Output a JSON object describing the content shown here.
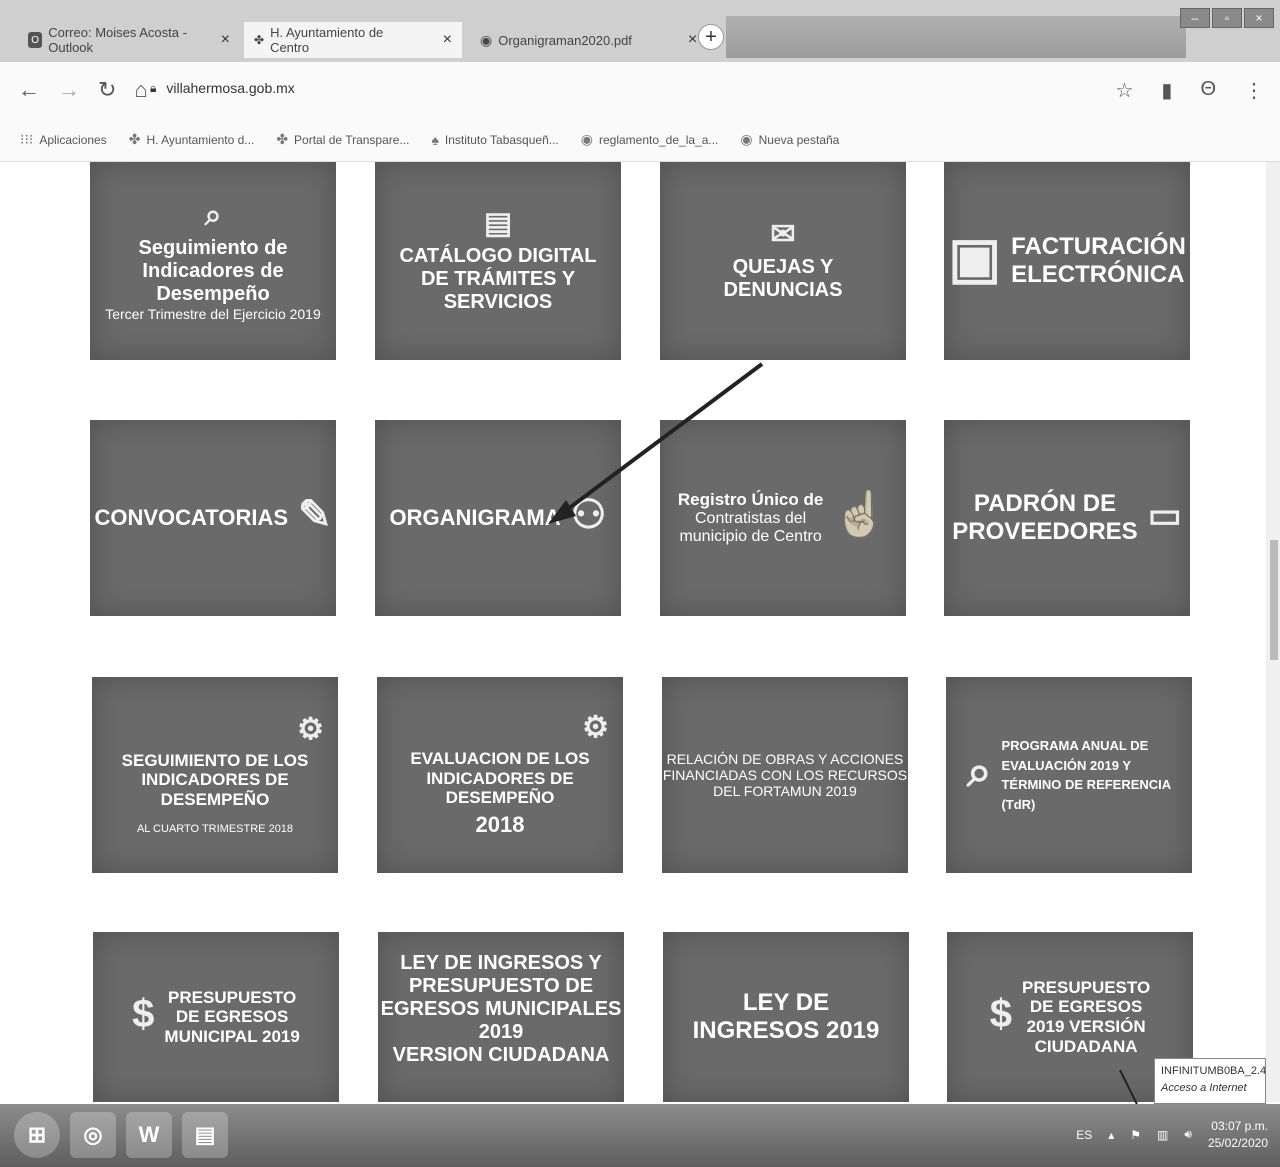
{
  "tabs": [
    {
      "label": "Correo: Moises Acosta - Outlook",
      "icon": "outlook-icon"
    },
    {
      "label": "H. Ayuntamiento de Centro",
      "icon": "palm-icon"
    },
    {
      "label": "Organigraman2020.pdf",
      "icon": "globe-icon"
    }
  ],
  "address": {
    "url": "villahermosa.gob.mx"
  },
  "bookmarks": [
    {
      "label": "Aplicaciones"
    },
    {
      "label": "H. Ayuntamiento d..."
    },
    {
      "label": "Portal de Transpare..."
    },
    {
      "label": "Instituto Tabasqueñ..."
    },
    {
      "label": "reglamento_de_la_a..."
    },
    {
      "label": "Nueva pestaña"
    }
  ],
  "tiles": {
    "seguimiento2019": {
      "line1": "Seguimiento de",
      "line2": "Indicadores de Desempeño",
      "line3": "Tercer Trimestre del Ejercicio 2019"
    },
    "catalogo": {
      "line1": "CATÁLOGO DIGITAL",
      "line2": "DE TRÁMITES Y SERVICIOS"
    },
    "quejas": {
      "line1": "QUEJAS Y",
      "line2": "DENUNCIAS"
    },
    "facturacion": {
      "line1": "FACTURACIÓN",
      "line2": "ELECTRÓNICA"
    },
    "convocatorias": {
      "line1": "CONVOCATORIAS"
    },
    "organigrama": {
      "line1": "ORGANIGRAMA"
    },
    "registro": {
      "line1": "Registro Único de",
      "line2": "Contratistas del",
      "line3": "municipio de Centro"
    },
    "padron": {
      "line1": "PADRÓN DE",
      "line2": "PROVEEDORES"
    },
    "seguimiento2018": {
      "line1": "SEGUIMIENTO DE LOS",
      "line2": "INDICADORES DE DESEMPEÑO",
      "line3": "AL CUARTO TRIMESTRE 2018"
    },
    "evaluacion": {
      "line1": "EVALUACION DE LOS",
      "line2": "INDICADORES DE DESEMPEÑO",
      "line3": "2018"
    },
    "relacion": {
      "line1": "RELACIÓN DE OBRAS Y ACCIONES",
      "line2": "FINANCIADAS CON LOS RECURSOS",
      "line3": "DEL FORTAMUN 2019"
    },
    "programa": {
      "line1": "PROGRAMA ANUAL DE",
      "line2": "EVALUACIÓN 2019 Y",
      "line3": "TÉRMINO DE REFERENCIA",
      "line4": "(TdR)"
    },
    "presupuesto2019": {
      "line1": "PRESUPUESTO",
      "line2": "DE EGRESOS",
      "line3": "MUNICIPAL 2019"
    },
    "ley_presupuesto": {
      "line1": "LEY DE INGRESOS Y",
      "line2": "PRESUPUESTO DE",
      "line3": "EGRESOS MUNICIPALES",
      "line4": "2019",
      "line5": "VERSION CIUDADANA"
    },
    "ley_ingresos": {
      "line1": "LEY DE",
      "line2": "INGRESOS 2019"
    },
    "presupuesto_ciudadana": {
      "line1": "PRESUPUESTO",
      "line2": "DE EGRESOS",
      "line3": "2019 VERSIÓN",
      "line4": "CIUDADANA"
    }
  },
  "tooltip": {
    "line1": "INFINITUMB0BA_2.4",
    "line2": "Acceso a Internet"
  },
  "taskbar": {
    "lang": "ES",
    "time": "03:07 p.m.",
    "date": "25/02/2020",
    "word_label": "W"
  }
}
